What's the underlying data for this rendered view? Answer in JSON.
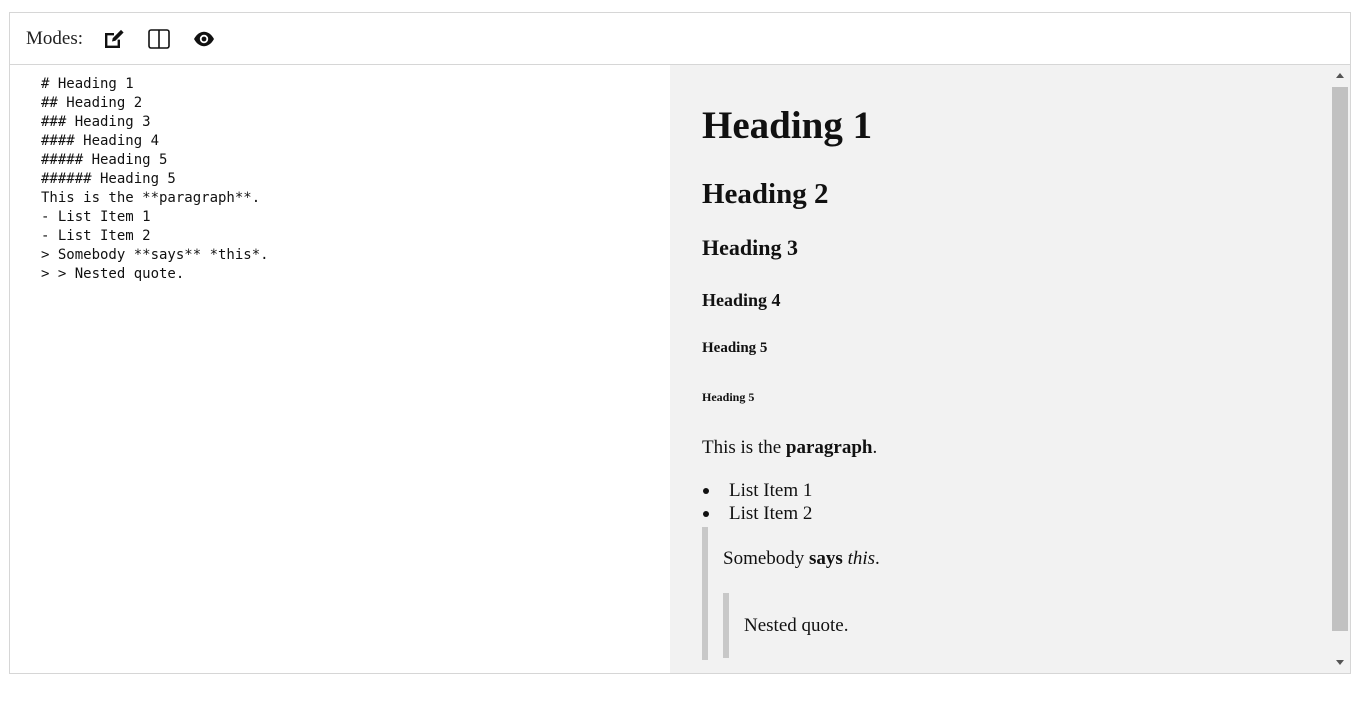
{
  "toolbar": {
    "label": "Modes:",
    "modes": [
      {
        "name": "edit",
        "icon": "edit-icon"
      },
      {
        "name": "split",
        "icon": "split-view-icon"
      },
      {
        "name": "preview",
        "icon": "eye-icon"
      }
    ]
  },
  "source": {
    "lines": [
      "# Heading 1",
      "## Heading 2",
      "### Heading 3",
      "#### Heading 4",
      "##### Heading 5",
      "###### Heading 5",
      "This is the **paragraph**.",
      "- List Item 1",
      "- List Item 2",
      "> Somebody **says** *this*.",
      "> > Nested quote."
    ]
  },
  "preview": {
    "h1": "Heading 1",
    "h2": "Heading 2",
    "h3": "Heading 3",
    "h4": "Heading 4",
    "h5": "Heading 5",
    "h6": "Heading 5",
    "paragraph": {
      "before": "This is the ",
      "bold": "paragraph",
      "after": "."
    },
    "list": [
      "List Item 1",
      "List Item 2"
    ],
    "quote": {
      "before": "Somebody ",
      "bold": "says",
      "space": " ",
      "italic": "this",
      "after": "."
    },
    "nested_quote": "Nested quote."
  },
  "colors": {
    "border": "#d6d6d6",
    "preview_bg": "#f2f2f2",
    "quote_bar": "#c8c8c8",
    "scroll_thumb": "#c1c1c1"
  }
}
